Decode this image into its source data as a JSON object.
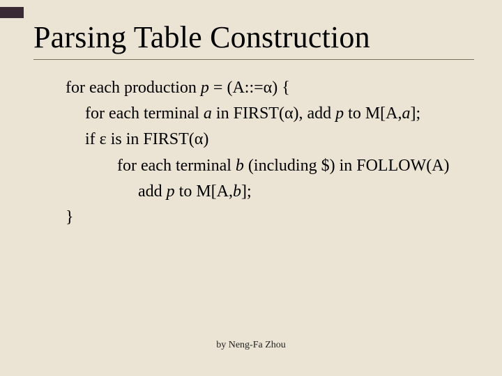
{
  "title": "Parsing Table Construction",
  "lines": {
    "l1a": "for each production ",
    "l1b": "p",
    "l1c": " = (A::=α)  {",
    "l2a": "for each terminal ",
    "l2b": "a",
    "l2c": " in FIRST(α), add ",
    "l2d": "p",
    "l2e": " to M[A,",
    "l2f": "a",
    "l2g": "];",
    "l3a": "if ε is in FIRST(α)",
    "l4a": "for each terminal ",
    "l4b": "b",
    "l4c": " (including $) in FOLLOW(A)",
    "l5a": "add ",
    "l5b": "p",
    "l5c": " to M[A,",
    "l5d": "b",
    "l5e": "];",
    "l6a": "}"
  },
  "footer": "by Neng-Fa Zhou"
}
